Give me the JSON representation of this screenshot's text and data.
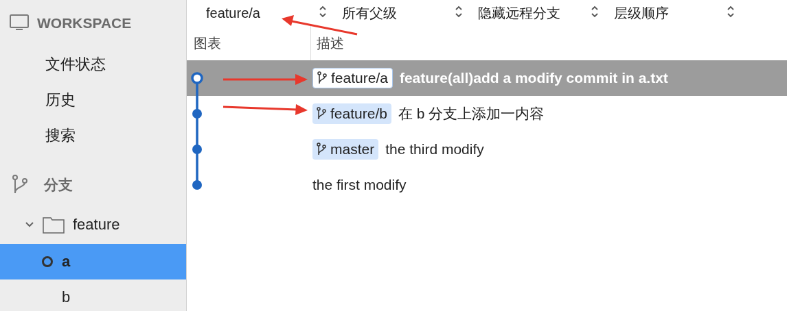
{
  "sidebar": {
    "workspace": {
      "title": "WORKSPACE",
      "items": [
        {
          "label": "文件状态",
          "selected": false
        },
        {
          "label": "历史",
          "selected": false
        },
        {
          "label": "搜索",
          "selected": false
        }
      ]
    },
    "branches": {
      "title": "分支",
      "tree": [
        {
          "label": "feature",
          "expanded": true,
          "children": [
            {
              "label": "a",
              "selected": true,
              "current": true
            },
            {
              "label": "b",
              "selected": false,
              "current": false
            }
          ]
        }
      ]
    }
  },
  "toolbar": {
    "dropdowns": [
      {
        "value": "feature/a"
      },
      {
        "value": "所有父级"
      },
      {
        "value": "隐藏远程分支"
      },
      {
        "value": "层级顺序"
      }
    ]
  },
  "table": {
    "columns": [
      "图表",
      "描述"
    ],
    "rows": [
      {
        "selected": true,
        "current": true,
        "tags": [
          "feature/a"
        ],
        "message": "feature(all)add a modify commit in a.txt"
      },
      {
        "selected": false,
        "current": false,
        "tags": [
          "feature/b"
        ],
        "message": "在 b 分支上添加一内容"
      },
      {
        "selected": false,
        "current": false,
        "tags": [
          "master"
        ],
        "message": "the third modify"
      },
      {
        "selected": false,
        "current": false,
        "tags": [],
        "message": "the first modify"
      }
    ]
  }
}
